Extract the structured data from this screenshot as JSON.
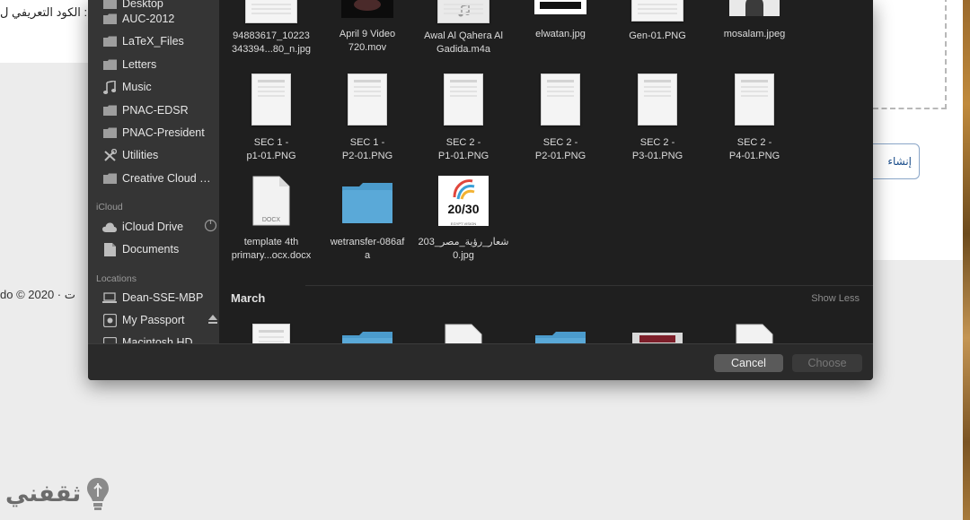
{
  "background": {
    "arabic_line": ": الكود التعريفي ل",
    "button_label": "إنشاء",
    "footer_text": "do © 2020 · ت"
  },
  "watermark": {
    "text": "ثقفني"
  },
  "sidebar": {
    "favorites": [
      {
        "label": "Desktop",
        "icon": "folder-icon"
      },
      {
        "label": "AUC-2012",
        "icon": "folder-icon"
      },
      {
        "label": "LaTeX_Files",
        "icon": "folder-icon"
      },
      {
        "label": "Letters",
        "icon": "folder-icon"
      },
      {
        "label": "Music",
        "icon": "music-icon"
      },
      {
        "label": "PNAC-EDSR",
        "icon": "folder-icon"
      },
      {
        "label": "PNAC-President",
        "icon": "folder-icon"
      },
      {
        "label": "Utilities",
        "icon": "tools-icon"
      },
      {
        "label": "Creative Cloud Files",
        "icon": "folder-icon"
      }
    ],
    "icloud_header": "iCloud",
    "icloud": [
      {
        "label": "iCloud Drive",
        "icon": "cloud-icon"
      },
      {
        "label": "Documents",
        "icon": "document-icon"
      }
    ],
    "locations_header": "Locations",
    "locations": [
      {
        "label": "Dean-SSE-MBP",
        "icon": "laptop-icon"
      },
      {
        "label": "My Passport",
        "icon": "drive-icon"
      },
      {
        "label": "Macintosh HD",
        "icon": "drive-icon"
      }
    ]
  },
  "files": {
    "row1": [
      {
        "name": "94883617_10223343394...80_n.jpg",
        "line1": "94883617_10223",
        "line2": "343394...80_n.jpg",
        "kind": "image"
      },
      {
        "name": "April 9 Video 720.mov",
        "line1": "April 9 Video",
        "line2": "720.mov",
        "kind": "video"
      },
      {
        "name": "Awal Al Qahera Al Gadida.m4a",
        "line1": "Awal Al Qahera Al",
        "line2": "Gadida.m4a",
        "kind": "audio"
      },
      {
        "name": "elwatan.jpg",
        "line1": "elwatan.jpg",
        "line2": "",
        "kind": "logo"
      },
      {
        "name": "Gen-01.PNG",
        "line1": "Gen-01.PNG",
        "line2": "",
        "kind": "doc"
      },
      {
        "name": "mosalam.jpeg",
        "line1": "mosalam.jpeg",
        "line2": "",
        "kind": "photo"
      }
    ],
    "row2": [
      {
        "line1": "SEC 1 -",
        "line2": "p1-01.PNG"
      },
      {
        "line1": "SEC 1 -",
        "line2": "P2-01.PNG"
      },
      {
        "line1": "SEC 2 -",
        "line2": "P1-01.PNG"
      },
      {
        "line1": "SEC 2 -",
        "line2": "P2-01.PNG"
      },
      {
        "line1": "SEC 2 -",
        "line2": "P3-01.PNG"
      },
      {
        "line1": "SEC 2 -",
        "line2": "P4-01.PNG"
      }
    ],
    "row3": [
      {
        "line1": "template 4th",
        "line2": "primary...ocx.docx",
        "badge": "DOCX"
      },
      {
        "line1": "wetransfer-086af",
        "line2": "a"
      },
      {
        "line1": "شعار_رؤية_مصر_203",
        "line2": "0.jpg",
        "logo_text": "20/30",
        "logo_sub": "EGYPT VISION"
      }
    ]
  },
  "section": {
    "title": "March",
    "toggle": "Show Less"
  },
  "buttons": {
    "cancel": "Cancel",
    "choose": "Choose"
  },
  "colors": {
    "folder": "#5aa9d8",
    "sidebar_bg": "#353535",
    "main_bg": "#1f1f1f"
  }
}
